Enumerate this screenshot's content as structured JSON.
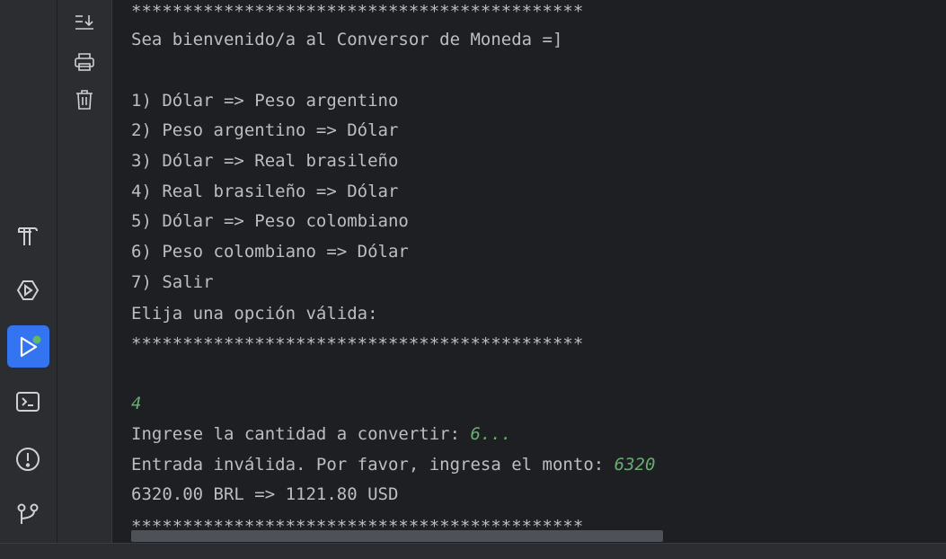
{
  "console": {
    "separator": "********************************************",
    "welcome": "Sea bienvenido/a al Conversor de Moneda =]",
    "options": [
      "1) Dólar => Peso argentino",
      "2) Peso argentino => Dólar",
      "3) Dólar => Real brasileño",
      "4) Real brasileño => Dólar",
      "5) Dólar => Peso colombiano",
      "6) Peso colombiano => Dólar",
      "7) Salir"
    ],
    "prompt": "Elija una opción válida:",
    "user_choice": "4",
    "amount_prompt": "Ingrese la cantidad a convertir: ",
    "amount_input": "6...",
    "invalid_prompt": "Entrada inválida. Por favor, ingresa el monto: ",
    "invalid_input": "6320",
    "result": "6320.00 BRL => 1121.80 USD"
  },
  "icons": {
    "tool_strip": [
      "scroll-to-end-icon",
      "print-icon",
      "trash-icon"
    ],
    "left_bar": [
      "build-hammer-icon",
      "services-icon",
      "run-icon",
      "terminal-icon",
      "problems-icon",
      "git-branch-icon"
    ]
  },
  "colors": {
    "background": "#1e1f22",
    "panel": "#2b2d30",
    "text": "#bcbec4",
    "user_input": "#6aab73",
    "active_accent": "#3574f0",
    "running_dot": "#5fb865"
  }
}
